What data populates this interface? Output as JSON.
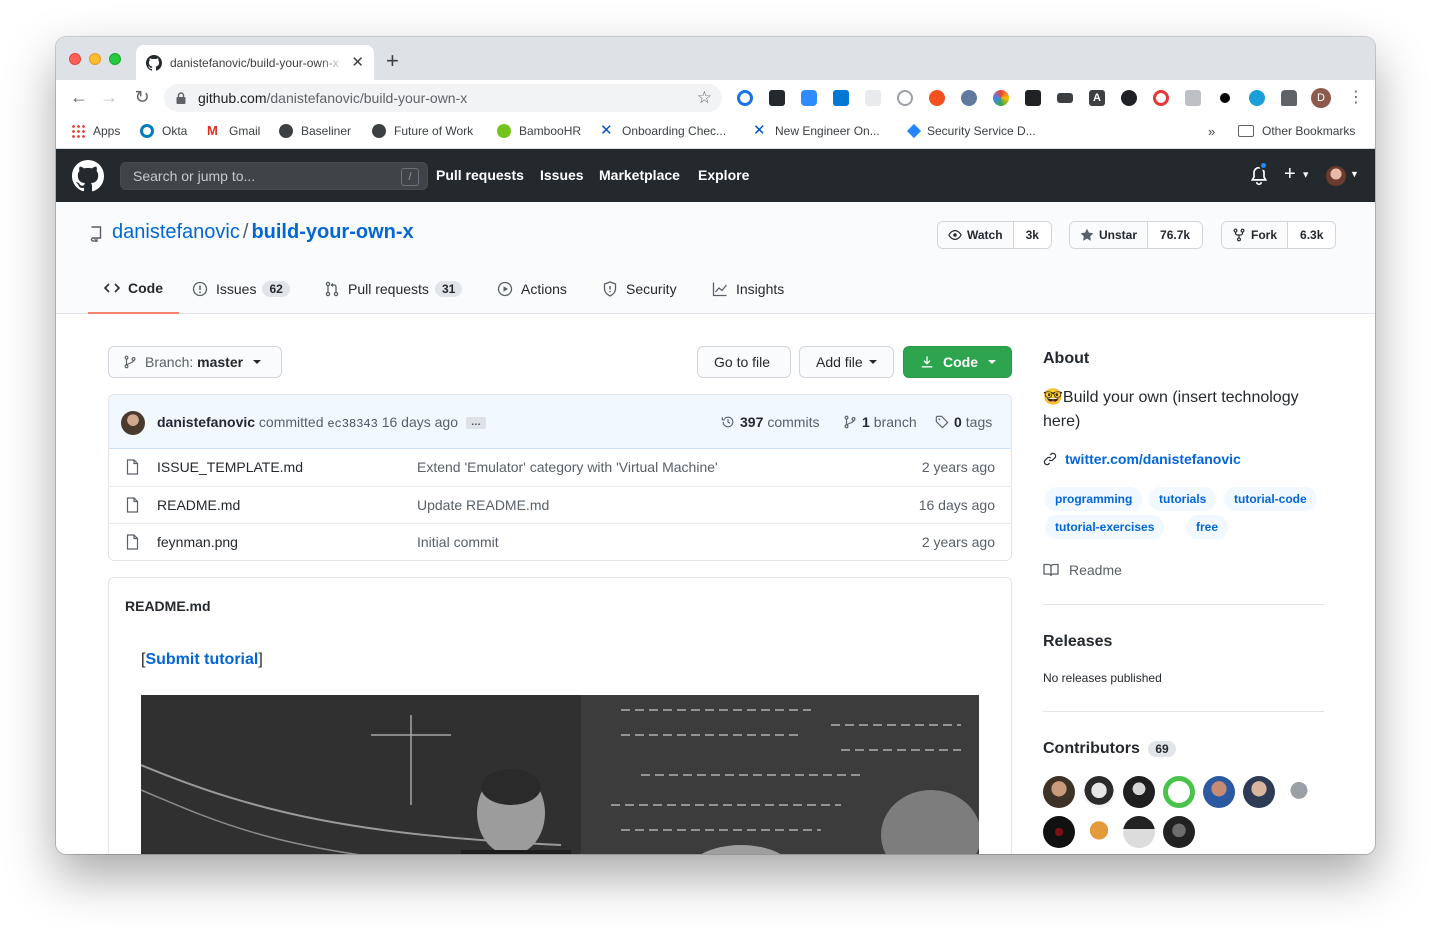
{
  "browser": {
    "tab_title": "danistefanovic/build-your-own-x",
    "tab_close": "✕",
    "new_tab": "+",
    "url_host": "github.com",
    "url_path": "/danistefanovic/build-your-own-x",
    "profile_initial": "D",
    "bookmarks": [
      {
        "label": "Apps",
        "color": "#4285f4"
      },
      {
        "label": "Okta",
        "color": "#007dc1"
      },
      {
        "label": "Gmail",
        "color": "#d93025"
      },
      {
        "label": "Baseliner",
        "color": "#3c4043"
      },
      {
        "label": "Future of Work",
        "color": "#3c4043"
      },
      {
        "label": "BambooHR",
        "color": "#73c41d"
      },
      {
        "label": "Onboarding Chec...",
        "color": "#0052cc"
      },
      {
        "label": "New Engineer On...",
        "color": "#0052cc"
      },
      {
        "label": "Security Service D...",
        "color": "#2684ff"
      }
    ],
    "bookmarks_overflow": "»",
    "other_bookmarks": "Other Bookmarks"
  },
  "gh": {
    "search_placeholder": "Search or jump to...",
    "slash_key": "/",
    "nav": [
      "Pull requests",
      "Issues",
      "Marketplace",
      "Explore"
    ],
    "plus": "+"
  },
  "repo": {
    "owner": "danistefanovic",
    "separator": "/",
    "name": "build-your-own-x",
    "watch_label": "Watch",
    "watch_count": "3k",
    "star_label": "Unstar",
    "star_count": "76.7k",
    "fork_label": "Fork",
    "fork_count": "6.3k",
    "tabs": [
      {
        "label": "Code",
        "count": ""
      },
      {
        "label": "Issues",
        "count": "62"
      },
      {
        "label": "Pull requests",
        "count": "31"
      },
      {
        "label": "Actions",
        "count": ""
      },
      {
        "label": "Security",
        "count": ""
      },
      {
        "label": "Insights",
        "count": ""
      }
    ]
  },
  "main": {
    "branch_prefix": "Branch:",
    "branch_name": "master",
    "go_to_file": "Go to file",
    "add_file": "Add file",
    "code_button": "Code",
    "commit": {
      "author": "danistefanovic",
      "action": "committed",
      "sha": "ec38343",
      "age": "16 days ago",
      "ellipsis": "…",
      "commits_count": "397",
      "commits_label": "commits",
      "branches_count": "1",
      "branches_label": "branch",
      "tags_count": "0",
      "tags_label": "tags"
    },
    "files": [
      {
        "name": "ISSUE_TEMPLATE.md",
        "message": "Extend 'Emulator' category with 'Virtual Machine'",
        "age": "2 years ago"
      },
      {
        "name": "README.md",
        "message": "Update README.md",
        "age": "16 days ago"
      },
      {
        "name": "feynman.png",
        "message": "Initial commit",
        "age": "2 years ago"
      }
    ],
    "readme": {
      "title": "README.md",
      "bracket_open": "[",
      "submit_link": "Submit tutorial",
      "bracket_close": "]"
    }
  },
  "sidebar": {
    "about_heading": "About",
    "about_emoji": "🤓",
    "about_text": "Build your own (insert technology here)",
    "website": "twitter.com/danistefanovic",
    "topics": [
      "programming",
      "tutorials",
      "tutorial-code",
      "tutorial-exercises",
      "free"
    ],
    "readme_label": "Readme",
    "releases_heading": "Releases",
    "releases_empty": "No releases published",
    "contributors_heading": "Contributors",
    "contributors_count": "69"
  },
  "colors": {
    "link": "#0366d6",
    "header_bg": "#24292e",
    "green_button": "#2ea44f",
    "tab_underline": "#f9826c"
  }
}
